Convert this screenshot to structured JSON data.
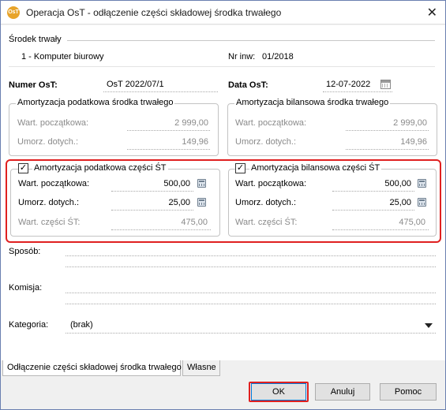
{
  "window": {
    "app_icon_text": "OsT",
    "title": "Operacja OsT - odłączenie części składowej środka trwałego",
    "close_glyph": "✕"
  },
  "asset": {
    "section_label": "Środek trwały",
    "name": "1 - Komputer biurowy",
    "inventory_label": "Nr inw:",
    "inventory_value": "01/2018"
  },
  "document": {
    "number_label": "Numer OsT:",
    "number_value": "OsT 2022/07/1",
    "date_label": "Data OsT:",
    "date_value": "12-07-2022"
  },
  "tax_asset": {
    "title": "Amortyzacja podatkowa środka trwałego",
    "initial_label": "Wart. początkowa:",
    "initial_value": "2 999,00",
    "redemption_label": "Umorz. dotych.:",
    "redemption_value": "149,96"
  },
  "balance_asset": {
    "title": "Amortyzacja bilansowa środka trwałego",
    "initial_label": "Wart. początkowa:",
    "initial_value": "2 999,00",
    "redemption_label": "Umorz. dotych.:",
    "redemption_value": "149,96"
  },
  "tax_part": {
    "checked": true,
    "check_glyph": "✓",
    "title": "Amortyzacja podatkowa części ŚT",
    "initial_label": "Wart. początkowa:",
    "initial_value": "500,00",
    "redemption_label": "Umorz. dotych.:",
    "redemption_value": "25,00",
    "part_value_label": "Wart. części ŚT:",
    "part_value": "475,00"
  },
  "balance_part": {
    "checked": true,
    "check_glyph": "✓",
    "title": "Amortyzacja bilansowa części ŚT",
    "initial_label": "Wart. początkowa:",
    "initial_value": "500,00",
    "redemption_label": "Umorz. dotych.:",
    "redemption_value": "25,00",
    "part_value_label": "Wart. części ŚT:",
    "part_value": "475,00"
  },
  "misc": {
    "method_label": "Sposób:",
    "method_value": "",
    "commission_label": "Komisja:",
    "commission_value": "",
    "category_label": "Kategoria:",
    "category_value": "(brak)"
  },
  "tabs": [
    {
      "label": "Odłączenie części składowej środka trwałego",
      "active": true
    },
    {
      "label": "Własne",
      "active": false
    }
  ],
  "buttons": {
    "ok": "OK",
    "cancel": "Anuluj",
    "help": "Pomoc"
  },
  "colors": {
    "highlight": "#e02020",
    "default_button_border": "#0078d7"
  },
  "icons": [
    "app-icon",
    "close-icon",
    "calendar-icon",
    "calculator-icon",
    "checkbox-checked",
    "chevron-down-icon"
  ]
}
